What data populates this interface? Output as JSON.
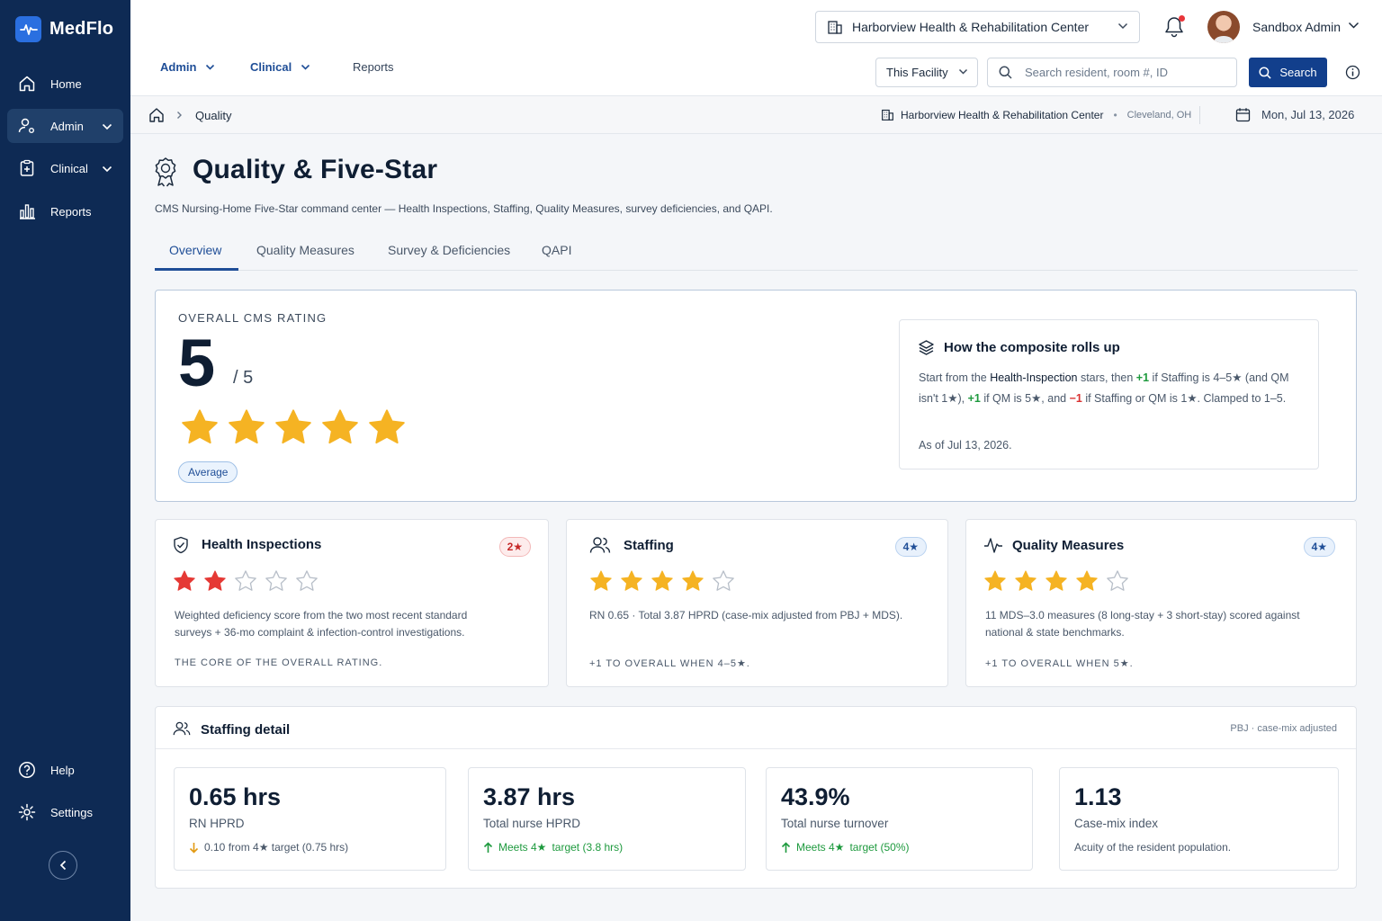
{
  "app": {
    "name": "MedFlo",
    "accent": "#2a6fe0",
    "sidebar_bg": "#0e2a54"
  },
  "sidebar": {
    "items": [
      {
        "label": "Home",
        "icon": "home-icon"
      },
      {
        "label": "Admin",
        "icon": "user-gear-icon"
      },
      {
        "label": "Clinical",
        "icon": "clipboard-plus-icon"
      },
      {
        "label": "Reports",
        "icon": "bar-chart-icon"
      }
    ],
    "bottom": [
      {
        "label": "Help",
        "icon": "help-icon"
      },
      {
        "label": "Settings",
        "icon": "gear-icon"
      }
    ]
  },
  "header": {
    "facility": "Harborview Health & Rehabilitation Center",
    "user_name": "Sandbox Admin",
    "nav": [
      {
        "label": "Admin"
      },
      {
        "label": "Clinical"
      },
      {
        "label": "Reports"
      }
    ],
    "scope": "This Facility",
    "search_placeholder": "Search resident, room #, ID",
    "search_label": "Search"
  },
  "breadcrumb": {
    "current": "Quality",
    "facility": "Harborview Health & Rehabilitation Center",
    "city": "Cleveland, OH",
    "date": "Mon, Jul 13, 2026"
  },
  "page": {
    "title": "Quality & Five-Star",
    "subtitle": "CMS Nursing-Home Five-Star command center — Health Inspections, Staffing, Quality Measures, survey deficiencies, and QAPI.",
    "tabs": [
      "Overview",
      "Quality Measures",
      "Survey & Deficiencies",
      "QAPI"
    ],
    "active_tab": "Overview"
  },
  "overall": {
    "label": "OVERALL CMS RATING",
    "score": "5",
    "max": "/ 5",
    "stars": 5,
    "badge": "Average",
    "composite": {
      "title": "How the composite rolls up",
      "p1": "Start from the ",
      "p1b": "Health-Inspection",
      "p2": " stars, then ",
      "plus1": "+1",
      "p3": " if Staffing is 4–5★ (and QM isn't 1★), ",
      "plus2": "+1",
      "p4": " if QM is 5★, and ",
      "minus1": "−1",
      "p5": " if Staffing or QM is 1★. Clamped to 1–5.",
      "as_of": "As of Jul 13, 2026."
    }
  },
  "components": [
    {
      "title": "Health Inspections",
      "pill": "2★",
      "stars": 2,
      "star_color": "#e53935",
      "desc1": "Weighted deficiency score from the two most recent standard",
      "desc2": "surveys + 36-mo complaint & infection-control investigations.",
      "foot": "THE CORE OF THE OVERALL RATING."
    },
    {
      "title": "Staffing",
      "pill": "4★",
      "stars": 4,
      "star_color": "#f5b323",
      "desc1": "RN 0.65 · Total 3.87 HPRD (case-mix adjusted from PBJ + MDS).",
      "desc2": "",
      "foot": "+1 TO OVERALL WHEN 4–5★."
    },
    {
      "title": "Quality Measures",
      "pill": "4★",
      "stars": 4,
      "star_color": "#f5b323",
      "desc1": "11 MDS–3.0 measures (8 long-stay + 3 short-stay) scored against",
      "desc2": "national & state benchmarks.",
      "foot": "+1 TO OVERALL WHEN 5★."
    }
  ],
  "staffing_detail": {
    "title": "Staffing detail",
    "note": "PBJ · case-mix adjusted",
    "metrics": [
      {
        "value": "0.65 hrs",
        "label": "RN HPRD",
        "sub_a": "0.10 from 4★ target (0.75 hrs)",
        "sub_b": "",
        "trend": "down"
      },
      {
        "value": "3.87 hrs",
        "label": "Total nurse HPRD",
        "sub_a": "Meets 4★",
        "sub_b": "target (3.8 hrs)",
        "trend": "up"
      },
      {
        "value": "43.9%",
        "label": "Total nurse turnover",
        "sub_a": "Meets 4★",
        "sub_b": "target (50%)",
        "trend": "up"
      },
      {
        "value": "1.13",
        "label": "Case-mix index",
        "sub_a": "Acuity of the resident population.",
        "sub_b": "",
        "trend": "none"
      }
    ]
  }
}
